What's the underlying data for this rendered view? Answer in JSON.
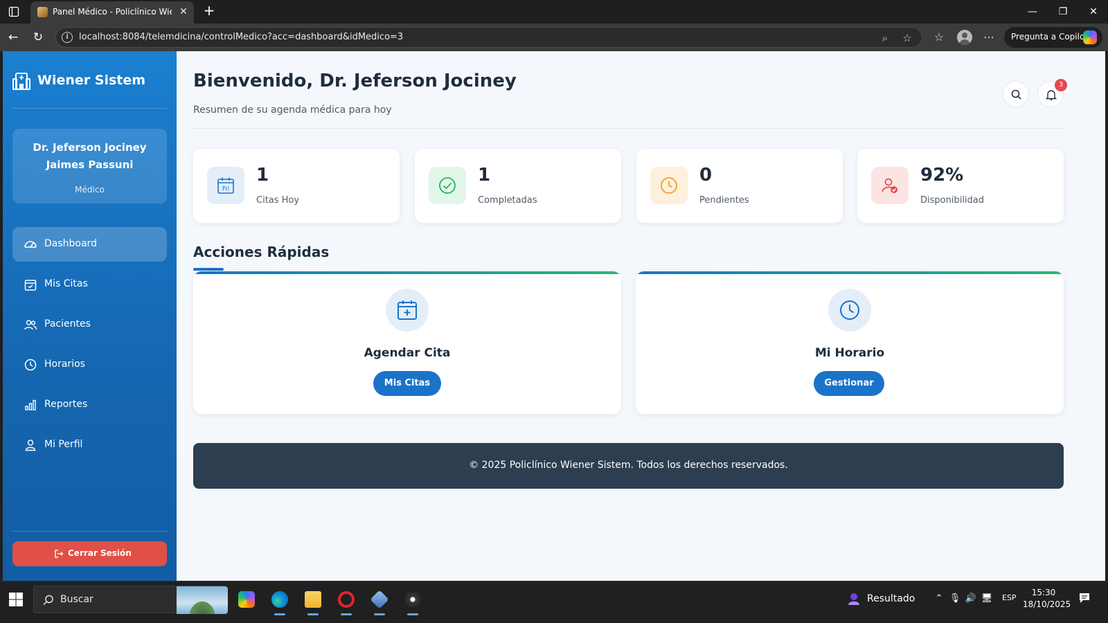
{
  "browser": {
    "tab_title": "Panel Médico - Policlínico Wiener",
    "url": "localhost:8084/telemdicina/controlMedico?acc=dashboard&idMedico=3",
    "copilot_label": "Pregunta a Copilot"
  },
  "app": {
    "brand": "Wiener Sistem",
    "user": {
      "name": "Dr. Jeferson Jociney Jaimes Passuni",
      "role": "Médico"
    },
    "menu": [
      {
        "label": "Dashboard",
        "icon": "gauge-icon",
        "active": true
      },
      {
        "label": "Mis Citas",
        "icon": "calendar-check-icon",
        "active": false
      },
      {
        "label": "Pacientes",
        "icon": "users-icon",
        "active": false
      },
      {
        "label": "Horarios",
        "icon": "clock-icon",
        "active": false
      },
      {
        "label": "Reportes",
        "icon": "bar-chart-icon",
        "active": false
      },
      {
        "label": "Mi Perfil",
        "icon": "user-icon",
        "active": false
      }
    ],
    "logout_label": "Cerrar Sesión"
  },
  "header": {
    "title": "Bienvenido, Dr. Jeferson Jociney",
    "subtitle": "Resumen de su agenda médica para hoy",
    "notification_count": "3"
  },
  "stats": [
    {
      "value": "1",
      "label": "Citas Hoy",
      "icon": "calendar-icon",
      "icon_text": "Fri",
      "color": "#1a73c8",
      "bg": "#e3eef9"
    },
    {
      "value": "1",
      "label": "Completadas",
      "icon": "check-circle-icon",
      "color": "#22b45e",
      "bg": "#e2f6ea"
    },
    {
      "value": "0",
      "label": "Pendientes",
      "icon": "clock-icon",
      "color": "#f0a020",
      "bg": "#fdf0dc"
    },
    {
      "value": "92%",
      "label": "Disponibilidad",
      "icon": "user-check-icon",
      "color": "#e5484d",
      "bg": "#fde4e4"
    }
  ],
  "quick_actions": {
    "title": "Acciones Rápidas",
    "cards": [
      {
        "title": "Agendar Cita",
        "button": "Mis Citas",
        "icon": "calendar-plus-icon"
      },
      {
        "title": "Mi Horario",
        "button": "Gestionar",
        "icon": "clock-icon"
      }
    ]
  },
  "footer": {
    "text": "© 2025 Policlínico Wiener Sistem. Todos los derechos reservados."
  },
  "taskbar": {
    "search_placeholder": "Buscar",
    "weather_label": "Resultado",
    "language": "ESP",
    "time": "15:30",
    "date": "18/10/2025"
  },
  "colors": {
    "sidebar": "#1b7fd0",
    "primary": "#1a73c8",
    "logout": "#e05046",
    "footer": "#2d3e50"
  }
}
